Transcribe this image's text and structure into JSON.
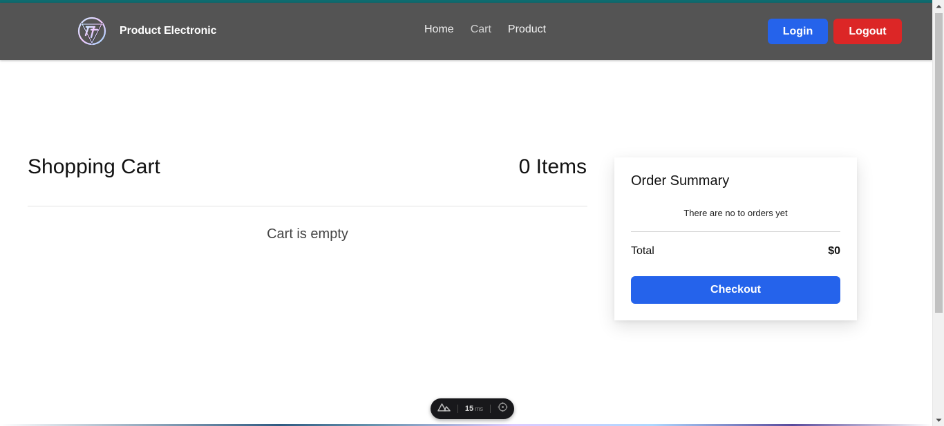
{
  "navbar": {
    "brand_name": "Product Electronic",
    "links": [
      {
        "label": "Home"
      },
      {
        "label": "Cart"
      },
      {
        "label": "Product"
      }
    ],
    "login_label": "Login",
    "logout_label": "Logout",
    "colors": {
      "bar": "#545454",
      "login": "#2563eb",
      "logout": "#dc2626"
    }
  },
  "cart": {
    "title": "Shopping Cart",
    "count_label": "0 Items",
    "empty_message": "Cart is empty"
  },
  "summary": {
    "title": "Order Summary",
    "message": "There are no to orders yet",
    "total_label": "Total",
    "total_value": "$0",
    "checkout_label": "Checkout"
  },
  "devtools": {
    "timing_value": "15",
    "timing_unit": "ms",
    "icons": [
      "nuxt-logo-icon",
      "crosshair-icon"
    ]
  }
}
